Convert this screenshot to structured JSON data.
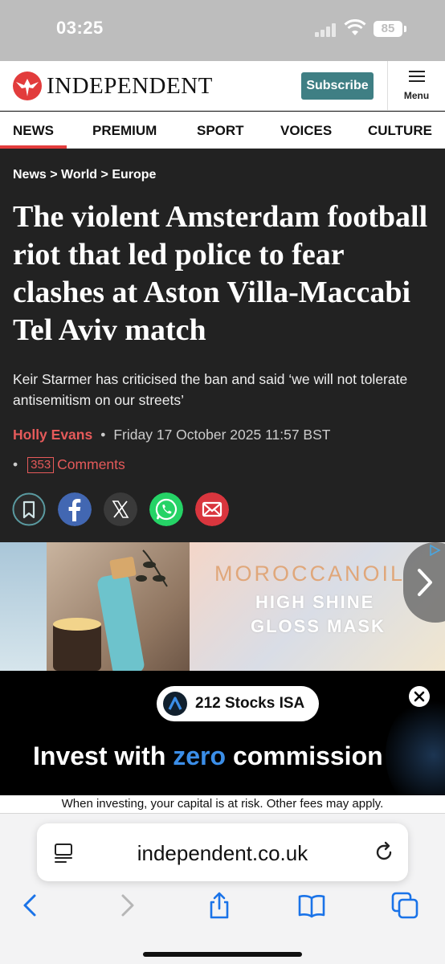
{
  "status_bar": {
    "time": "03:25",
    "battery": "85"
  },
  "header": {
    "logo_text": "INDEPENDENT",
    "subscribe_label": "Subscribe",
    "menu_label": "Menu",
    "brand_color": "#e23c3c",
    "subscribe_color": "#3f7f84"
  },
  "nav": {
    "items": [
      "NEWS",
      "PREMIUM",
      "SPORT",
      "VOICES",
      "CULTURE"
    ],
    "active": "NEWS"
  },
  "article": {
    "breadcrumb": [
      "News",
      "World",
      "Europe"
    ],
    "breadcrumb_sep": ">",
    "headline": "The violent Amsterdam football riot that led police to fear clashes at Aston Villa-Maccabi Tel Aviv match",
    "standfirst": "Keir Starmer has criticised the ban and said ‘we will not tolerate antisemitism on our streets’",
    "author": "Holly Evans",
    "date": "Friday 17 October 2025 11:57 BST",
    "bullet": "•",
    "comments_count": "353",
    "comments_label": "Comments",
    "share_icons": [
      "bookmark-icon",
      "facebook-icon",
      "x-icon",
      "whatsapp-icon",
      "email-icon"
    ]
  },
  "ad_banner": {
    "brand": "MOROCCANOIL",
    "tagline_1": "HIGH SHINE",
    "tagline_2": "GLOSS MASK"
  },
  "ad_invest": {
    "pill_text": "212 Stocks ISA",
    "tagline_before": "Invest with ",
    "tagline_highlight": "zero",
    "tagline_after": " commission",
    "disclaimer": "When investing, your capital is at risk. Other fees may apply."
  },
  "browser": {
    "url": "independent.co.uk",
    "accent_color": "#1a73e8"
  }
}
